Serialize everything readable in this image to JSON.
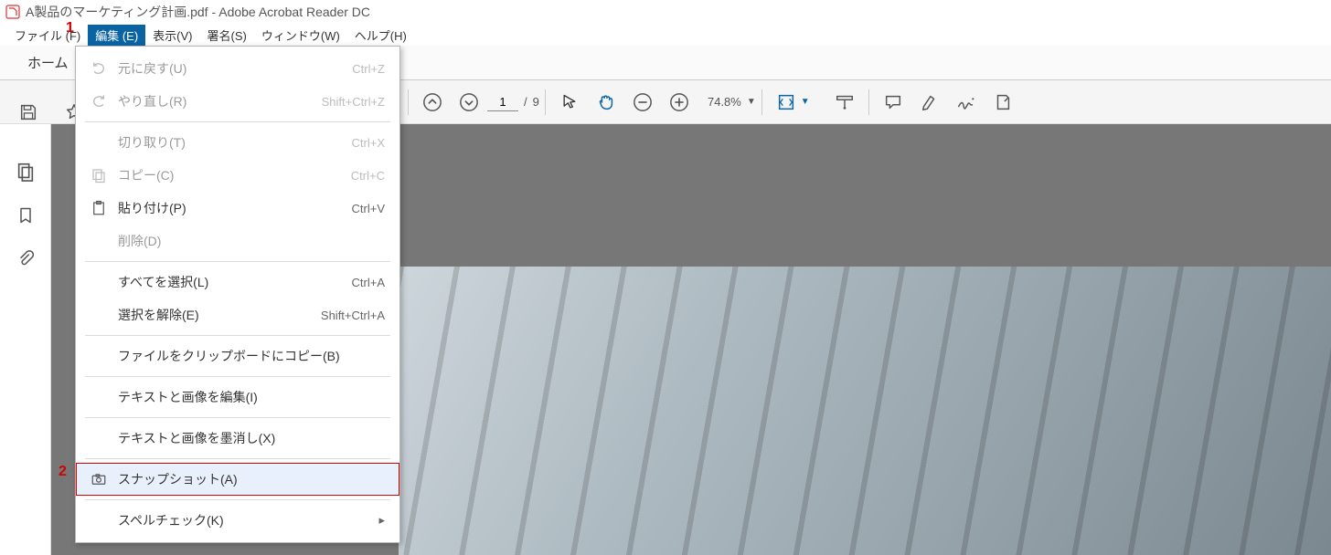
{
  "window": {
    "title": "A製品のマーケティング計画.pdf - Adobe Acrobat Reader DC"
  },
  "callouts": {
    "one": "1",
    "two": "2"
  },
  "menubar": {
    "file": "ファイル (F)",
    "edit": "編集 (E)",
    "view": "表示(V)",
    "sign": "署名(S)",
    "window": "ウィンドウ(W)",
    "help": "ヘルプ(H)"
  },
  "tabs": {
    "home": "ホーム"
  },
  "toolbar": {
    "page_current": "1",
    "page_sep": "/",
    "page_total": "9",
    "zoom_value": "74.8%"
  },
  "dropdown": {
    "undo": {
      "label": "元に戻す(U)",
      "shortcut": "Ctrl+Z"
    },
    "redo": {
      "label": "やり直し(R)",
      "shortcut": "Shift+Ctrl+Z"
    },
    "cut": {
      "label": "切り取り(T)",
      "shortcut": "Ctrl+X"
    },
    "copy": {
      "label": "コピー(C)",
      "shortcut": "Ctrl+C"
    },
    "paste": {
      "label": "貼り付け(P)",
      "shortcut": "Ctrl+V"
    },
    "delete": {
      "label": "削除(D)",
      "shortcut": ""
    },
    "select_all": {
      "label": "すべてを選択(L)",
      "shortcut": "Ctrl+A"
    },
    "deselect": {
      "label": "選択を解除(E)",
      "shortcut": "Shift+Ctrl+A"
    },
    "copy_file": {
      "label": "ファイルをクリップボードにコピー(B)",
      "shortcut": ""
    },
    "edit_text_image": {
      "label": "テキストと画像を編集(I)",
      "shortcut": ""
    },
    "redact": {
      "label": "テキストと画像を墨消し(X)",
      "shortcut": ""
    },
    "snapshot": {
      "label": "スナップショット(A)",
      "shortcut": ""
    },
    "spellcheck": {
      "label": "スペルチェック(K)",
      "shortcut": ""
    }
  }
}
